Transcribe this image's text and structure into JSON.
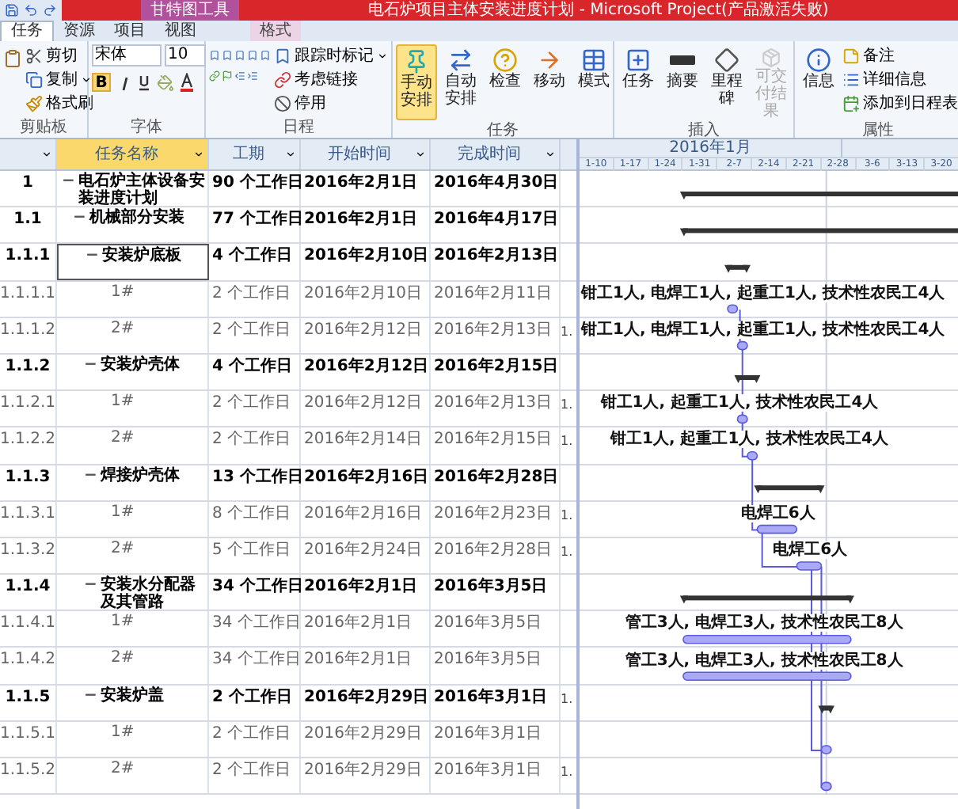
{
  "window": {
    "title": "电石炉项目主体安装进度计划 - Microsoft Project(产品激活失败)",
    "context_tab": "甘特图工具"
  },
  "ribbon_tabs": [
    {
      "label": "任务",
      "selected": true,
      "kind": "main"
    },
    {
      "label": "资源",
      "selected": false,
      "kind": "main"
    },
    {
      "label": "项目",
      "selected": false,
      "kind": "main"
    },
    {
      "label": "视图",
      "selected": false,
      "kind": "main"
    },
    {
      "label": "格式",
      "selected": false,
      "kind": "context"
    }
  ],
  "clipboard": {
    "items": [
      "剪切",
      "复制",
      "格式刷"
    ],
    "label": "剪贴板"
  },
  "font": {
    "name": "宋体",
    "size": "10",
    "bold": true,
    "bold_key": "B",
    "label": "字体"
  },
  "schedule": {
    "items": [
      "跟踪时标记",
      "考虑链接",
      "停用"
    ],
    "label": "日程"
  },
  "tasks": {
    "buttons": [
      {
        "label": "手动安排",
        "selected": true
      },
      {
        "label": "自动安排",
        "selected": false
      },
      {
        "label": "检查",
        "selected": false
      },
      {
        "label": "移动",
        "selected": false
      },
      {
        "label": "模式",
        "selected": false
      }
    ],
    "label": "任务"
  },
  "insert": {
    "buttons": [
      {
        "label": "任务",
        "disabled": false
      },
      {
        "label": "摘要",
        "disabled": false
      },
      {
        "label": "里程碑",
        "disabled": false
      },
      {
        "label": "可交付结果",
        "disabled": true
      }
    ],
    "label": "插入"
  },
  "properties": {
    "button": "信息",
    "items": [
      "备注",
      "详细信息",
      "添加到日程表"
    ],
    "label": "属性"
  },
  "table": {
    "columns": [
      {
        "label": "任务名称",
        "selected": true
      },
      {
        "label": "工期",
        "selected": false
      },
      {
        "label": "开始时间",
        "selected": false
      },
      {
        "label": "完成时间",
        "selected": false
      }
    ],
    "rows": [
      {
        "id": "1",
        "name": "电石炉主体设备安装进度计划",
        "duration": "90 个工作日",
        "start": "2016年2月1日",
        "finish": "2016年4月30日",
        "kind": "summary",
        "toggle": "−",
        "selected": false,
        "children": [
          {
            "id": "1.1",
            "name": "机械部分安装",
            "duration": "77 个工作日",
            "start": "2016年2月1日",
            "finish": "2016年4月17日",
            "kind": "summary",
            "toggle": "−",
            "selected": false,
            "children": [
              {
                "id": "1.1.1",
                "name": "安装炉底板",
                "duration": "4 个工作日",
                "start": "2016年2月10日",
                "finish": "2016年2月13日",
                "kind": "summary",
                "toggle": "−",
                "selected": true,
                "children": [
                  {
                    "id": "1.1.1.1",
                    "name": "1#",
                    "duration": "2 个工作日",
                    "start": "2016年2月10日",
                    "finish": "2016年2月11日",
                    "kind": "task",
                    "selected": false,
                    "resources": "钳工1人, 电焊工1人, 起重工1人, 技术性农民工4人"
                  },
                  {
                    "id": "1.1.1.2",
                    "name": "2#",
                    "duration": "2 个工作日",
                    "start": "2016年2月12日",
                    "finish": "2016年2月13日",
                    "kind": "task",
                    "selected": false,
                    "column_6": "1.",
                    "resources": "钳工1人, 电焊工1人, 起重工1人, 技术性农民工4人"
                  }
                ]
              },
              {
                "id": "1.1.2",
                "name": "安装炉壳体",
                "duration": "4 个工作日",
                "start": "2016年2月12日",
                "finish": "2016年2月15日",
                "kind": "summary",
                "toggle": "−",
                "selected": false,
                "children": [
                  {
                    "id": "1.1.2.1",
                    "name": "1#",
                    "duration": "2 个工作日",
                    "start": "2016年2月12日",
                    "finish": "2016年2月13日",
                    "kind": "task",
                    "selected": false,
                    "column_6": "1.",
                    "resources": "钳工1人, 起重工1人, 技术性农民工4人"
                  },
                  {
                    "id": "1.1.2.2",
                    "name": "2#",
                    "duration": "2 个工作日",
                    "start": "2016年2月14日",
                    "finish": "2016年2月15日",
                    "kind": "task",
                    "selected": false,
                    "column_6": "1.",
                    "resources": "钳工1人, 起重工1人, 技术性农民工4人"
                  }
                ]
              },
              {
                "id": "1.1.3",
                "name": "焊接炉壳体",
                "duration": "13 个工作日",
                "start": "2016年2月16日",
                "finish": "2016年2月28日",
                "kind": "summary",
                "toggle": "−",
                "selected": false,
                "children": [
                  {
                    "id": "1.1.3.1",
                    "name": "1#",
                    "duration": "8 个工作日",
                    "start": "2016年2月16日",
                    "finish": "2016年2月23日",
                    "kind": "task",
                    "selected": false,
                    "column_6": "1.",
                    "resources": "电焊工6人"
                  },
                  {
                    "id": "1.1.3.2",
                    "name": "2#",
                    "duration": "5 个工作日",
                    "start": "2016年2月24日",
                    "finish": "2016年2月28日",
                    "kind": "task",
                    "selected": false,
                    "column_6": "1.",
                    "resources": "电焊工6人"
                  }
                ]
              },
              {
                "id": "1.1.4",
                "name": "安装水分配器及其管路",
                "duration": "34 个工作日",
                "start": "2016年2月1日",
                "finish": "2016年3月5日",
                "kind": "summary",
                "toggle": "−",
                "selected": false,
                "children": [
                  {
                    "id": "1.1.4.1",
                    "name": "1#",
                    "duration": "34 个工作日",
                    "start": "2016年2月1日",
                    "finish": "2016年3月5日",
                    "kind": "task",
                    "selected": false,
                    "resources": "管工3人, 电焊工3人, 技术性农民工8人"
                  },
                  {
                    "id": "1.1.4.2",
                    "name": "2#",
                    "duration": "34 个工作日",
                    "start": "2016年2月1日",
                    "finish": "2016年3月5日",
                    "kind": "task",
                    "selected": false,
                    "resources": "管工3人, 电焊工3人, 技术性农民工8人"
                  }
                ]
              },
              {
                "id": "1.1.5",
                "name": "安装炉盖",
                "duration": "2 个工作日",
                "start": "2016年2月29日",
                "finish": "2016年3月1日",
                "kind": "summary",
                "toggle": "−",
                "selected": false,
                "column_6": "1.",
                "children": [
                  {
                    "id": "1.1.5.1",
                    "name": "1#",
                    "duration": "2 个工作日",
                    "start": "2016年2月29日",
                    "finish": "2016年3月1日",
                    "kind": "task",
                    "selected": false
                  },
                  {
                    "id": "1.1.5.2",
                    "name": "2#",
                    "duration": "2 个工作日",
                    "start": "2016年2月29日",
                    "finish": "2016年3月1日",
                    "kind": "task",
                    "selected": false,
                    "column_6": "1."
                  }
                ]
              }
            ]
          }
        ]
      }
    ]
  },
  "timescale": {
    "month": "2016年1月",
    "weeks": [
      "1-10",
      "1-17",
      "1-24",
      "1-31",
      "2-7",
      "2-14",
      "2-21",
      "2-28",
      "3-6",
      "3-13",
      "3-20"
    ]
  }
}
